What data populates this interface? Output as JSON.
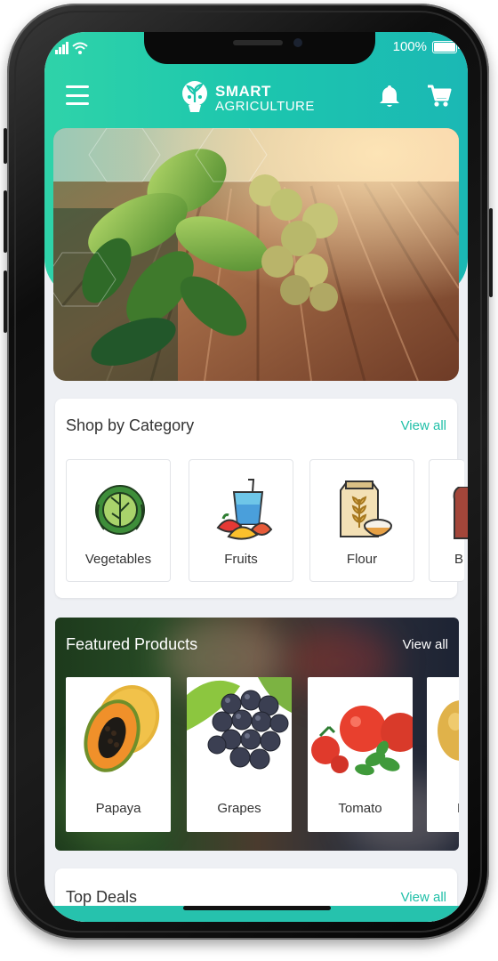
{
  "status_bar": {
    "battery": "100%"
  },
  "app": {
    "logo_line1": "SMART",
    "logo_line2": "AGRICULTURE"
  },
  "categories": {
    "title": "Shop by Category",
    "view_all": "View all",
    "items": [
      {
        "label": "Vegetables",
        "icon": "cabbage-icon"
      },
      {
        "label": "Fruits",
        "icon": "fruit-juice-icon"
      },
      {
        "label": "Flour",
        "icon": "flour-sack-icon"
      },
      {
        "label": "B",
        "icon": "bread-icon"
      }
    ]
  },
  "featured": {
    "title": "Featured Products",
    "view_all": "View all",
    "items": [
      {
        "label": "Papaya"
      },
      {
        "label": "Grapes"
      },
      {
        "label": "Tomato"
      },
      {
        "label": "P"
      }
    ]
  },
  "top_deals": {
    "title": "Top Deals",
    "view_all": "View all"
  },
  "colors": {
    "accent": "#1ebfa7",
    "header": "#22c9ad"
  }
}
